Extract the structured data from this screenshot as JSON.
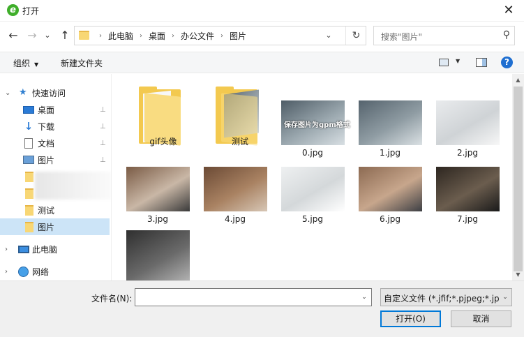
{
  "window": {
    "title": "打开",
    "close_glyph": "✕"
  },
  "navigation": {
    "back_glyph": "←",
    "forward_glyph": "→",
    "recent_glyph": "⌄",
    "up_glyph": "↑",
    "breadcrumb": [
      "此电脑",
      "桌面",
      "办公文件",
      "图片"
    ],
    "separator": "›",
    "dropdown_glyph": "⌄",
    "refresh_glyph": "↻"
  },
  "search": {
    "placeholder": "搜索\"图片\"",
    "icon": "search-icon"
  },
  "toolbar": {
    "organize_label": "组织",
    "new_folder_label": "新建文件夹",
    "help_glyph": "?"
  },
  "sidebar": {
    "quick_access": "快速访问",
    "items": [
      {
        "label": "桌面",
        "icon": "desktop-icon",
        "pinned": true
      },
      {
        "label": "下载",
        "icon": "download-icon",
        "pinned": true
      },
      {
        "label": "文档",
        "icon": "document-icon",
        "pinned": true
      },
      {
        "label": "图片",
        "icon": "pictures-icon",
        "pinned": true
      },
      {
        "label": "",
        "icon": "folder-icon",
        "pinned": false
      },
      {
        "label": "",
        "icon": "folder-icon",
        "pinned": false
      },
      {
        "label": "测试",
        "icon": "folder-icon",
        "pinned": false
      },
      {
        "label": "图片",
        "icon": "folder-icon",
        "pinned": false,
        "selected": true
      }
    ],
    "this_pc": "此电脑",
    "network": "网络",
    "pin_glyph": "📌",
    "expand_glyph": "›",
    "expanded_glyph": "⌄"
  },
  "files": [
    {
      "name": "gif头像",
      "kind": "folder"
    },
    {
      "name": "测试",
      "kind": "folder-with-image"
    },
    {
      "name": "0.jpg",
      "kind": "image",
      "overlay_text": "保存图片为gpm格式",
      "colors": [
        "#4e5c66",
        "#9aa7ae",
        "#d8dfe3"
      ]
    },
    {
      "name": "1.jpg",
      "kind": "image",
      "colors": [
        "#55636d",
        "#8f9ca3",
        "#dbe1e4"
      ]
    },
    {
      "name": "2.jpg",
      "kind": "image",
      "colors": [
        "#e9ebed",
        "#cfd3d6",
        "#f7f7f7"
      ]
    },
    {
      "name": "3.jpg",
      "kind": "image",
      "colors": [
        "#7a5b45",
        "#c9b7a6",
        "#3a3a3a"
      ]
    },
    {
      "name": "4.jpg",
      "kind": "image",
      "colors": [
        "#6b4a35",
        "#a98262",
        "#d7c7b6"
      ]
    },
    {
      "name": "5.jpg",
      "kind": "image",
      "colors": [
        "#eef0f1",
        "#d4d8da",
        "#ffffff"
      ]
    },
    {
      "name": "6.jpg",
      "kind": "image",
      "colors": [
        "#8c6a52",
        "#c7a68c",
        "#3d3f44"
      ]
    },
    {
      "name": "7.jpg",
      "kind": "image",
      "colors": [
        "#2d2620",
        "#6b5d4e",
        "#1a1a1a"
      ]
    },
    {
      "name": "",
      "kind": "image",
      "overlay_text": "",
      "colors": [
        "#2f2f2f",
        "#6a6a6a",
        "#bcbcbc"
      ]
    }
  ],
  "footer": {
    "filename_label": "文件名(N):",
    "filename_value": "",
    "filter_value": "自定义文件 (*.jfif;*.pjpeg;*.jpeg;*.pjp;*.jpg)",
    "open_label": "打开(O)",
    "cancel_label": "取消"
  },
  "colors": {
    "accent": "#0078d7",
    "selection": "#cce4f7",
    "folder": "#f8d775"
  }
}
